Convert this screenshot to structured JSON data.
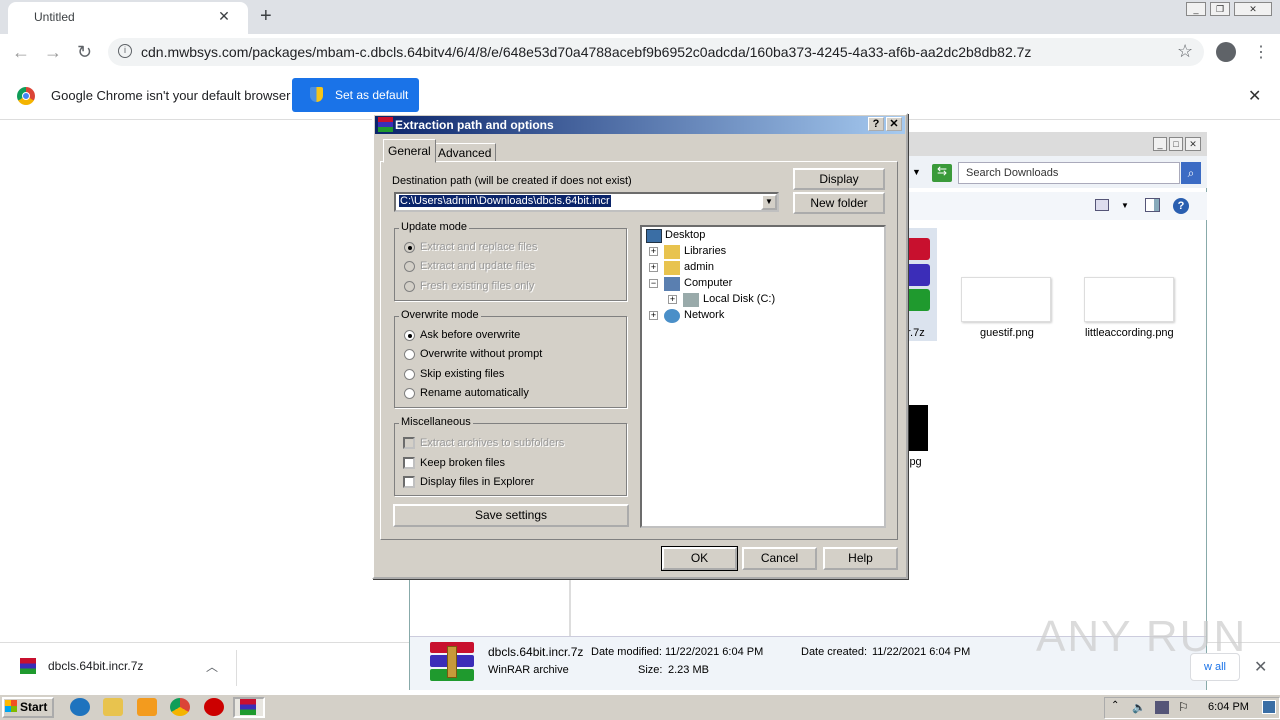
{
  "browser": {
    "tab_title": "Untitled",
    "url": "cdn.mwbsys.com/packages/mbam-c.dbcls.64bitv4/6/4/8/e/648e53d70a4788acebf9b6952c0adcda/160ba373-4245-4a33-af6b-aa2dc2b8db82.7z",
    "infobar_text": "Google Chrome isn't your default browser",
    "set_default_label": "Set as default",
    "download_file": "dbcls.64bit.incr.7z"
  },
  "explorer": {
    "search_placeholder": "Search Downloads",
    "files": [
      {
        "name": "guestif.png"
      },
      {
        "name": "littleaccording.png"
      }
    ],
    "partial_name_1": "r.7z",
    "partial_name_2": "jpg",
    "detail": {
      "name": "dbcls.64bit.incr.7z",
      "type": "WinRAR archive",
      "modified_label": "Date modified:",
      "modified": "11/22/2021 6:04 PM",
      "size_label": "Size:",
      "size": "2.23 MB",
      "created_label": "Date created:",
      "created": "11/22/2021 6:04 PM"
    },
    "show_all": "w all"
  },
  "dialog": {
    "title": "Extraction path and options",
    "tabs": [
      "General",
      "Advanced"
    ],
    "dest_label": "Destination path (will be created if does not exist)",
    "dest_value": "C:\\Users\\admin\\Downloads\\dbcls.64bit.incr",
    "display_btn": "Display",
    "new_folder_btn": "New folder",
    "update_mode": {
      "label": "Update mode",
      "options": [
        "Extract and replace files",
        "Extract and update files",
        "Fresh existing files only"
      ]
    },
    "overwrite_mode": {
      "label": "Overwrite mode",
      "options": [
        "Ask before overwrite",
        "Overwrite without prompt",
        "Skip existing files",
        "Rename automatically"
      ]
    },
    "misc": {
      "label": "Miscellaneous",
      "options": [
        "Extract archives to subfolders",
        "Keep broken files",
        "Display files in Explorer"
      ]
    },
    "save_settings": "Save settings",
    "tree": [
      "Desktop",
      "Libraries",
      "admin",
      "Computer",
      "Local Disk (C:)",
      "Network"
    ],
    "ok": "OK",
    "cancel": "Cancel",
    "help": "Help"
  },
  "taskbar": {
    "start": "Start",
    "clock": "6:04 PM"
  },
  "watermark": "ANY RUN"
}
